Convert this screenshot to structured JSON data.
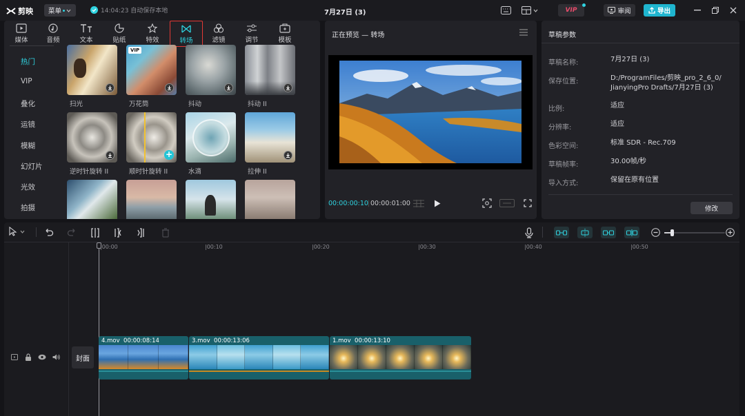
{
  "titlebar": {
    "logo": "剪映",
    "menu_label": "菜单",
    "autosave_text": "14:04:23 自动保存本地",
    "project_title": "7月27日 (3)",
    "vip_label": "VIP",
    "review_label": "审阅",
    "export_label": "导出"
  },
  "media_tabs": [
    {
      "label": "媒体"
    },
    {
      "label": "音频"
    },
    {
      "label": "文本"
    },
    {
      "label": "贴纸"
    },
    {
      "label": "特效"
    },
    {
      "label": "转场"
    },
    {
      "label": "滤镜"
    },
    {
      "label": "调节"
    },
    {
      "label": "模板"
    }
  ],
  "categories": [
    "热门",
    "VIP",
    "叠化",
    "运镜",
    "模糊",
    "幻灯片",
    "光效",
    "拍摄"
  ],
  "transitions": [
    {
      "label": "扫光"
    },
    {
      "label": "万花筒"
    },
    {
      "label": "抖动"
    },
    {
      "label": "抖动 II"
    },
    {
      "label": "逆时针旋转 II"
    },
    {
      "label": "顺时针旋转 II"
    },
    {
      "label": "水滴"
    },
    {
      "label": "拉伸 II"
    }
  ],
  "badges": {
    "vip": "VIP"
  },
  "preview": {
    "title": "正在预览 — 转场",
    "current_time": "00:00:00:10",
    "total_time": "00:00:01:00"
  },
  "params": {
    "title": "草稿参数",
    "rows": [
      {
        "label": "草稿名称:",
        "value": "7月27日 (3)"
      },
      {
        "label": "保存位置:",
        "value": "D:/ProgramFiles/剪映_pro_2_6_0/",
        "value2": "JianyingPro Drafts/7月27日 (3)"
      },
      {
        "label": "比例:",
        "value": "适应"
      },
      {
        "label": "分辨率:",
        "value": "适应"
      },
      {
        "label": "色彩空间:",
        "value": "标准 SDR - Rec.709"
      },
      {
        "label": "草稿帧率:",
        "value": "30.00帧/秒"
      },
      {
        "label": "导入方式:",
        "value": "保留在原有位置"
      }
    ],
    "edit_button": "修改"
  },
  "timeline": {
    "ticks": [
      "00:00",
      "00:10",
      "00:20",
      "00:30",
      "00:40",
      "00:50"
    ],
    "cover_label": "封面",
    "clips": [
      {
        "name": "4.mov",
        "duration": "00:00:08:14"
      },
      {
        "name": "3.mov",
        "duration": "00:00:13:06"
      },
      {
        "name": "1.mov",
        "duration": "00:00:13:10"
      }
    ]
  }
}
